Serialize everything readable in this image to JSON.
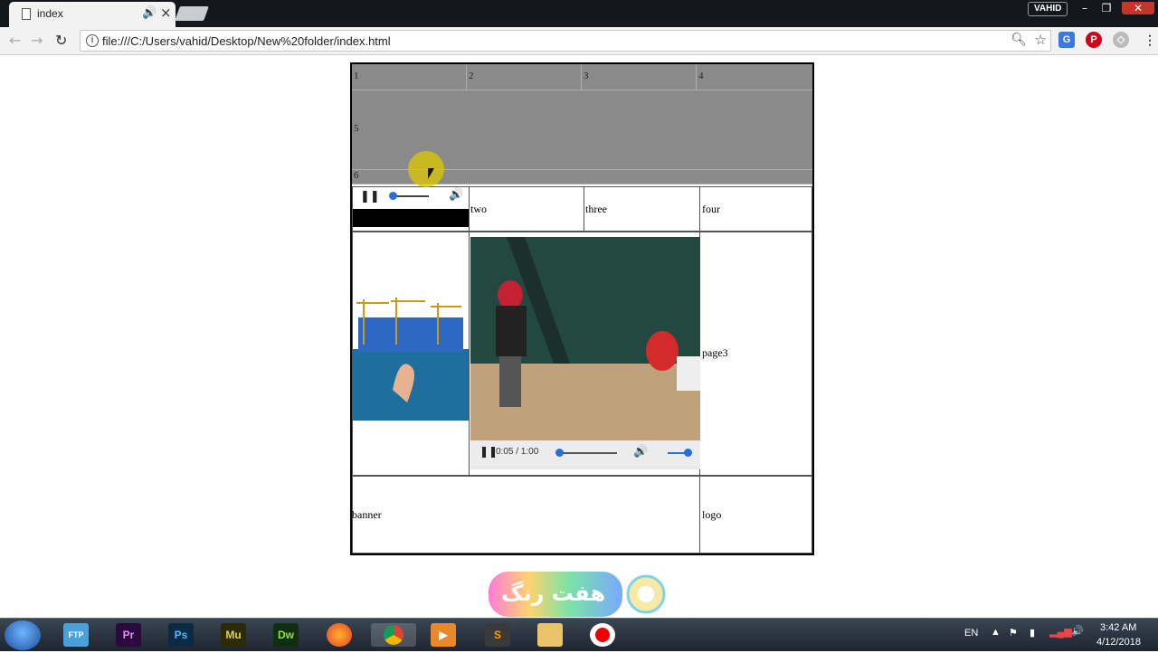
{
  "browser": {
    "tab_title": "index",
    "url": "file:///C:/Users/vahid/Desktop/New%20folder/index.html",
    "profile_name": "VAHID",
    "icons": [
      "page-icon",
      "sound-icon",
      "close-icon",
      "back-icon",
      "forward-icon",
      "reload-icon",
      "info-icon",
      "zoom-icon",
      "star-icon"
    ],
    "extensions": [
      "translate-icon",
      "pinterest-icon",
      "tag-icon",
      "menu-icon"
    ]
  },
  "page": {
    "top_grid": {
      "row1": [
        "1",
        "2",
        "3",
        "4"
      ],
      "row2": "5",
      "row3": "6"
    },
    "row_labels": [
      "two",
      "three",
      "four"
    ],
    "middle_right": "page3",
    "footer": {
      "banner": "banner",
      "logo": "logo"
    },
    "audio_player": {
      "state": "playing"
    },
    "video_player": {
      "time": "0:05 / 1:00",
      "state": "playing"
    }
  },
  "watermark_text": "هفت رنگ",
  "taskbar": {
    "apps": [
      "FTP",
      "Pr",
      "Ps",
      "Mu",
      "Dw",
      "firefox",
      "chrome",
      "media",
      "sublime",
      "explorer",
      "recorder"
    ],
    "language": "EN",
    "time": "3:42 AM",
    "date": "4/12/2018"
  },
  "colors": {
    "gray_block": "#8a8a8a",
    "accent_blue": "#2a6fd8",
    "taskbar": "#1d2530"
  }
}
